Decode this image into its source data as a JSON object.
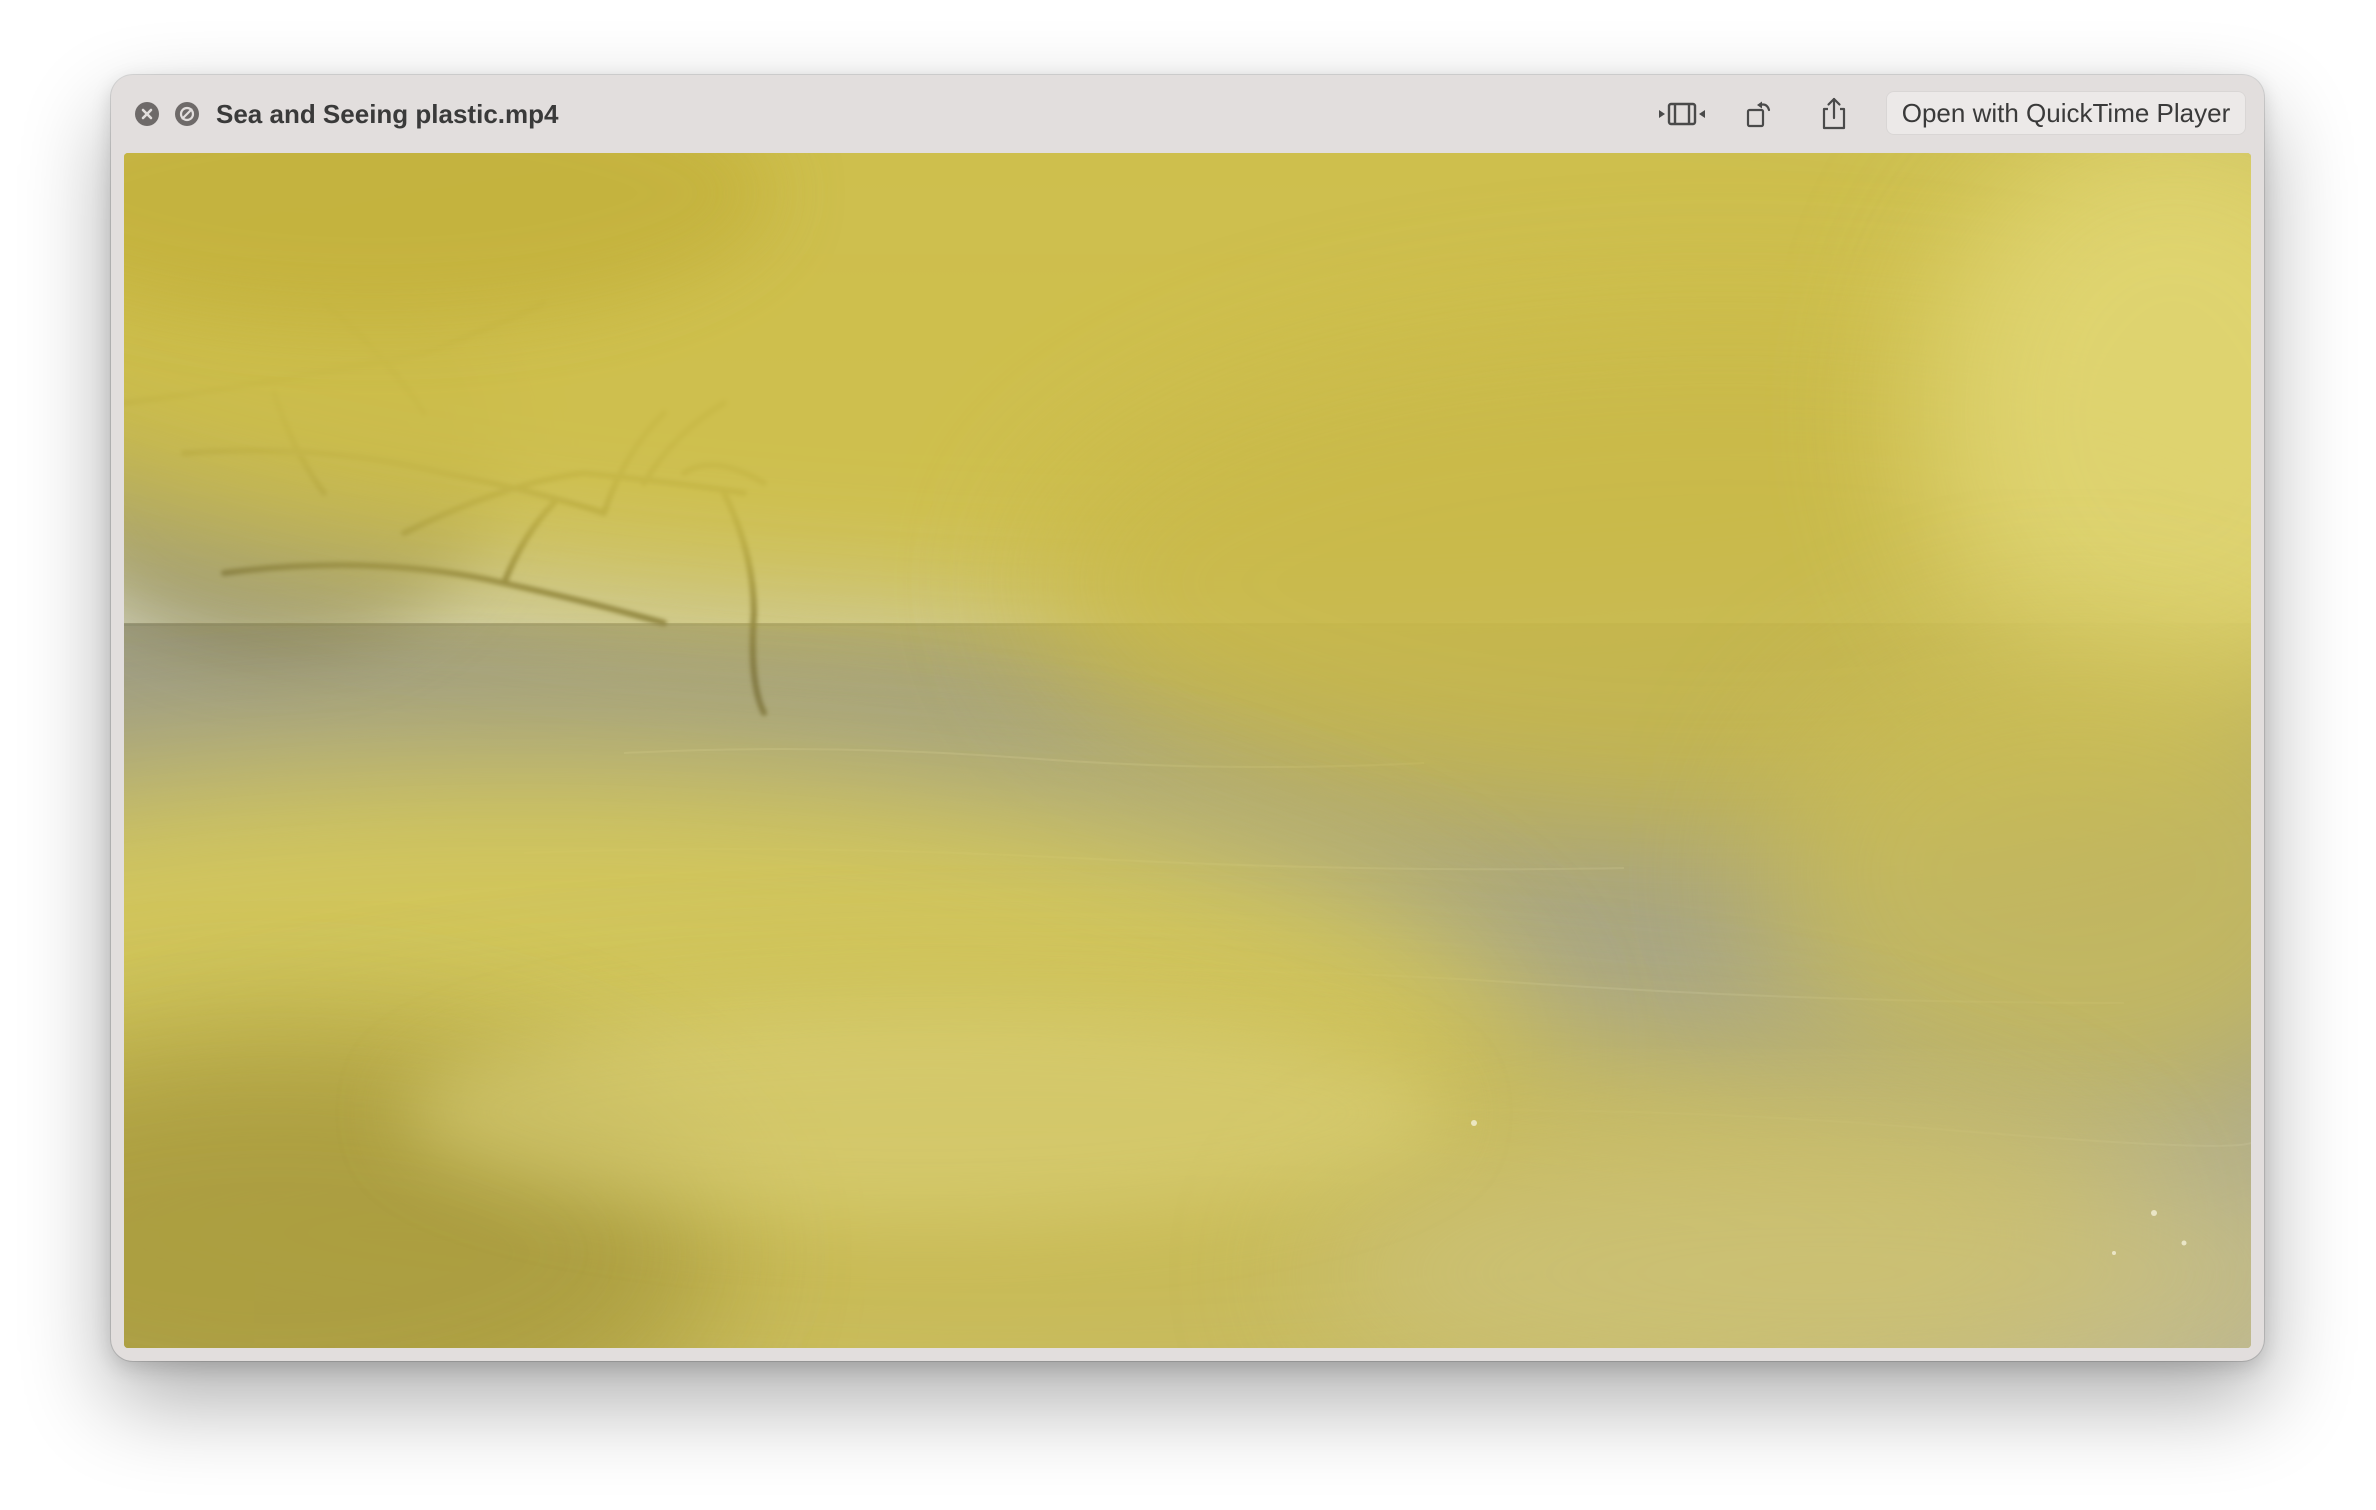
{
  "window": {
    "title": "Sea and Seeing plastic.mp4"
  },
  "titlebar": {
    "close_icon": "close-x-icon",
    "fullscreen_icon": "slash-circle-icon",
    "trim_icon": "trim-icon",
    "rotate_icon": "rotate-icon",
    "share_icon": "share-icon",
    "open_with_label": "Open with QuickTime Player"
  },
  "video": {
    "description_colors": {
      "foreground_plastic": "#d8cc5a",
      "sea": "#a7a589",
      "sky": "#c6c7b0"
    }
  }
}
